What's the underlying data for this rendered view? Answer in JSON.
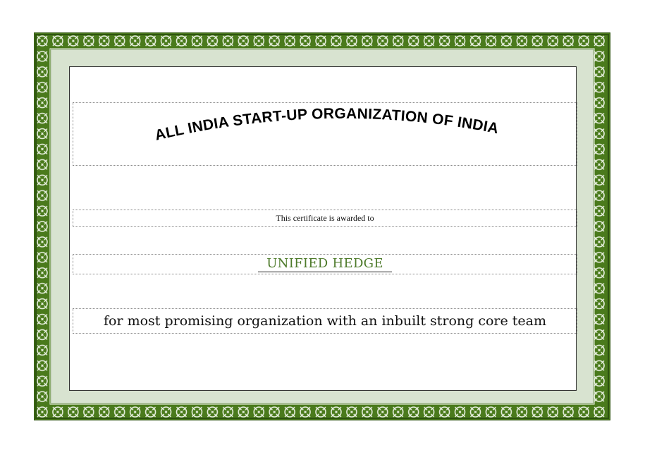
{
  "certificate": {
    "organization_title": "ALL INDIA START-UP ORGANIZATION OF INDIA",
    "awarded_line": "This certificate is awarded to",
    "recipient_name": "UNIFIED HEDGE",
    "reason": "for most promising organization with an inbuilt strong core team"
  },
  "colors": {
    "border_green": "#4a7a1c",
    "mat": "#d8e3d0",
    "recipient_name": "#4d7a2a"
  },
  "icons": {
    "border": "celtic-knot-border"
  }
}
